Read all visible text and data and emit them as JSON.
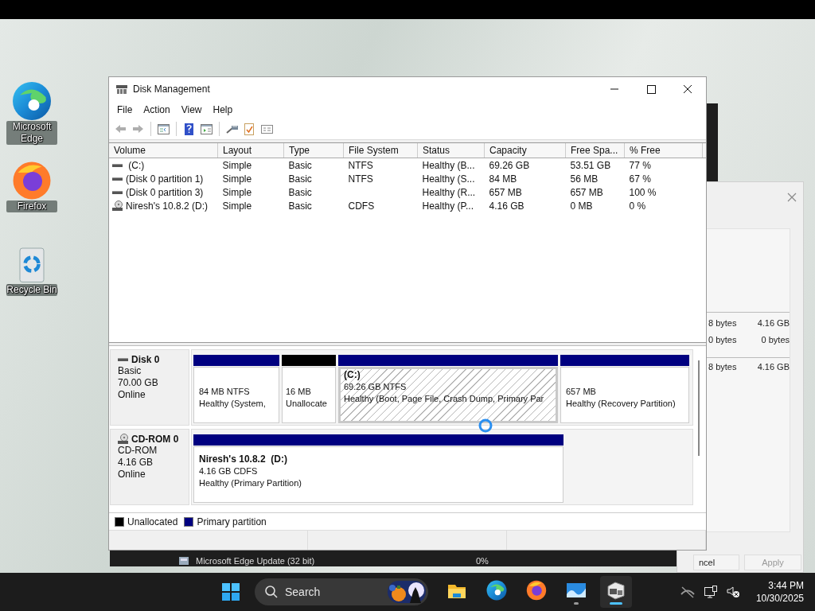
{
  "desktop_icons": [
    {
      "kind": "edge",
      "label": "Microsoft Edge"
    },
    {
      "kind": "firefox",
      "label": "Firefox"
    },
    {
      "kind": "recycle",
      "label": "Recycle Bin"
    }
  ],
  "background_window": {
    "process": "Microsoft Edge Update (32 bit)",
    "cpu": "0%"
  },
  "background_dialog": {
    "rows": [
      [
        "8 bytes",
        "4.16 GB"
      ],
      [
        "0 bytes",
        "0 bytes"
      ],
      [
        "8 bytes",
        "4.16 GB"
      ]
    ],
    "buttons": [
      {
        "label": "ncel",
        "disabled": false
      },
      {
        "label": "Apply",
        "disabled": true
      }
    ]
  },
  "window": {
    "title": "Disk Management",
    "menu": [
      "File",
      "Action",
      "View",
      "Help"
    ],
    "toolbar": [
      {
        "kind": "back",
        "disabled": true
      },
      {
        "kind": "forward",
        "disabled": true
      },
      {
        "kind": "sep"
      },
      {
        "kind": "tree",
        "disabled": false
      },
      {
        "kind": "sep"
      },
      {
        "kind": "help",
        "disabled": false
      },
      {
        "kind": "panel",
        "disabled": false
      },
      {
        "kind": "sep"
      },
      {
        "kind": "tool",
        "disabled": false
      },
      {
        "kind": "check",
        "disabled": false
      },
      {
        "kind": "card",
        "disabled": false
      }
    ],
    "volumes": {
      "columns": [
        "Volume",
        "Layout",
        "Type",
        "File System",
        "Status",
        "Capacity",
        "Free Spa...",
        "% Free"
      ],
      "rows": [
        {
          "kind": "disk",
          "cells": [
            " (C:)",
            "Simple",
            "Basic",
            "NTFS",
            "Healthy (B...",
            "69.26 GB",
            "53.51 GB",
            "77 %"
          ]
        },
        {
          "kind": "disk",
          "cells": [
            "(Disk 0 partition 1)",
            "Simple",
            "Basic",
            "NTFS",
            "Healthy (S...",
            "84 MB",
            "56 MB",
            "67 %"
          ]
        },
        {
          "kind": "disk",
          "cells": [
            "(Disk 0 partition 3)",
            "Simple",
            "Basic",
            "",
            "Healthy (R...",
            "657 MB",
            "657 MB",
            "100 %"
          ]
        },
        {
          "kind": "cdrom",
          "cells": [
            "Niresh's 10.8.2 (D:)",
            "Simple",
            "Basic",
            "CDFS",
            "Healthy (P...",
            "4.16 GB",
            "0 MB",
            "0 %"
          ]
        }
      ]
    },
    "disks": [
      {
        "kind": "disk",
        "name": "Disk 0",
        "info": [
          "Basic",
          "70.00 GB",
          "Online"
        ],
        "partitions": [
          {
            "kind": "primary",
            "selected": false,
            "lines": [
              "84 MB NTFS",
              "Healthy (System,"
            ]
          },
          {
            "kind": "unallocated",
            "selected": false,
            "lines": [
              "16 MB",
              "Unallocate"
            ]
          },
          {
            "kind": "primary",
            "selected": true,
            "name": "(C:)",
            "lines": [
              "69.26 GB NTFS",
              "Healthy (Boot, Page File, Crash Dump, Primary Par"
            ]
          },
          {
            "kind": "primary",
            "selected": false,
            "lines": [
              "657 MB",
              "Healthy (Recovery Partition)"
            ]
          }
        ]
      },
      {
        "kind": "cdrom",
        "name": "CD-ROM 0",
        "info": [
          "CD-ROM",
          "4.16 GB",
          "Online"
        ],
        "partitions": [
          {
            "kind": "primary",
            "selected": false,
            "name": "Niresh's 10.8.2  (D:)",
            "lines": [
              "4.16 GB CDFS",
              "Healthy (Primary Partition)"
            ]
          }
        ]
      }
    ],
    "legend": [
      {
        "kind": "unallocated",
        "label": "Unallocated"
      },
      {
        "kind": "primary",
        "label": "Primary partition"
      }
    ]
  },
  "taskbar": {
    "search": {
      "placeholder": "Search"
    },
    "apps": [
      {
        "kind": "explorer",
        "running": false,
        "active": false
      },
      {
        "kind": "edge",
        "running": false,
        "active": false
      },
      {
        "kind": "firefox",
        "running": false,
        "active": false
      },
      {
        "kind": "photos",
        "running": true,
        "active": false
      },
      {
        "kind": "diskmgmt",
        "running": true,
        "active": true
      }
    ],
    "time": "3:44 PM",
    "date": "10/30/2025"
  }
}
